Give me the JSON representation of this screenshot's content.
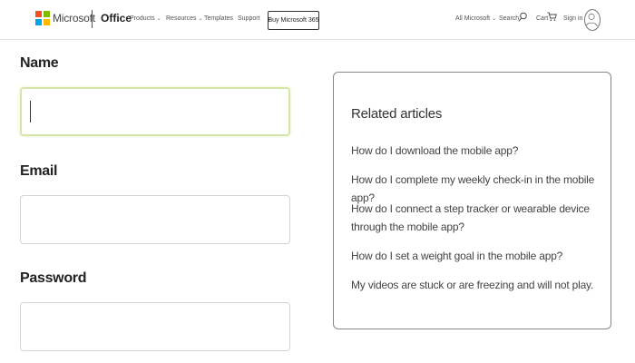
{
  "header": {
    "brand": "Microsoft",
    "office": "Office",
    "nav": [
      {
        "label": "Products",
        "dropdown": true
      },
      {
        "label": "Resources",
        "dropdown": true
      },
      {
        "label": "Templates",
        "dropdown": false
      },
      {
        "label": "Support",
        "dropdown": false
      }
    ],
    "buy_button": "Buy Microsoft 365",
    "all_microsoft": "All Microsoft",
    "search": "Search",
    "cart": "Cart",
    "signin": "Sign in",
    "logo_colors": [
      "#f25022",
      "#7fba00",
      "#00a4ef",
      "#ffb900"
    ]
  },
  "form": {
    "name_label": "Name",
    "name_value": "",
    "email_label": "Email",
    "email_value": "",
    "password_label": "Password",
    "password_value": ""
  },
  "related": {
    "title": "Related articles",
    "links": [
      "How do I download the mobile app?",
      "How do I complete my weekly check-in in the mobile app?",
      "How do I connect a step tracker or wearable device through the mobile app?",
      "How do I set a weight goal in the mobile app?",
      "My videos are stuck or are freezing and will not play."
    ]
  }
}
